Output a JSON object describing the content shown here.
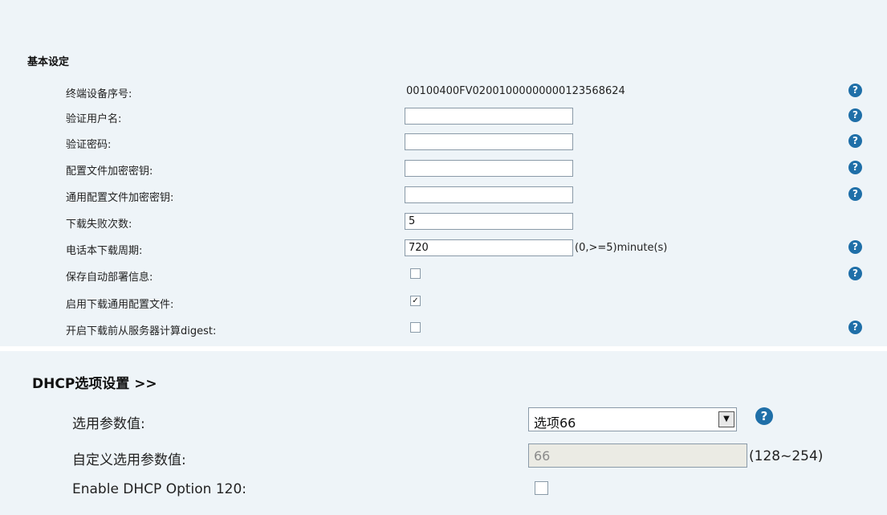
{
  "basic": {
    "title": "基本设定",
    "serial": {
      "label": "终端设备序号:",
      "value": "00100400FV02001000000000123568624"
    },
    "auth_user": {
      "label": "验证用户名:",
      "value": ""
    },
    "auth_pass": {
      "label": "验证密码:",
      "value": ""
    },
    "config_key": {
      "label": "配置文件加密密钥:",
      "value": ""
    },
    "common_config_key": {
      "label": "通用配置文件加密密钥:",
      "value": ""
    },
    "fail_count": {
      "label": "下载失败次数:",
      "value": "5"
    },
    "phonebook_period": {
      "label": "电话本下载周期:",
      "value": "720",
      "hint": "(0,>=5)minute(s)"
    },
    "save_autoprov": {
      "label": "保存自动部署信息:",
      "checked": false
    },
    "enable_common_config": {
      "label": "启用下载通用配置文件:",
      "checked": true,
      "mark": "✓"
    },
    "digest": {
      "label": "开启下载前从服务器计算digest:",
      "checked": false
    }
  },
  "dhcp": {
    "title": "DHCP选项设置 >>",
    "option_param": {
      "label": "选用参数值:",
      "selected": "选项66"
    },
    "custom_param": {
      "label": "自定义选用参数值:",
      "value": "66",
      "hint": "(128~254)"
    },
    "option120": {
      "label": "Enable DHCP Option 120:",
      "checked": false
    }
  },
  "help_glyph": "?",
  "dropdown_glyph": "▼",
  "colors": {
    "panel_bg": "#eef4f8",
    "help_icon": "#1f6fa8",
    "disabled_bg": "#ebebe4"
  }
}
